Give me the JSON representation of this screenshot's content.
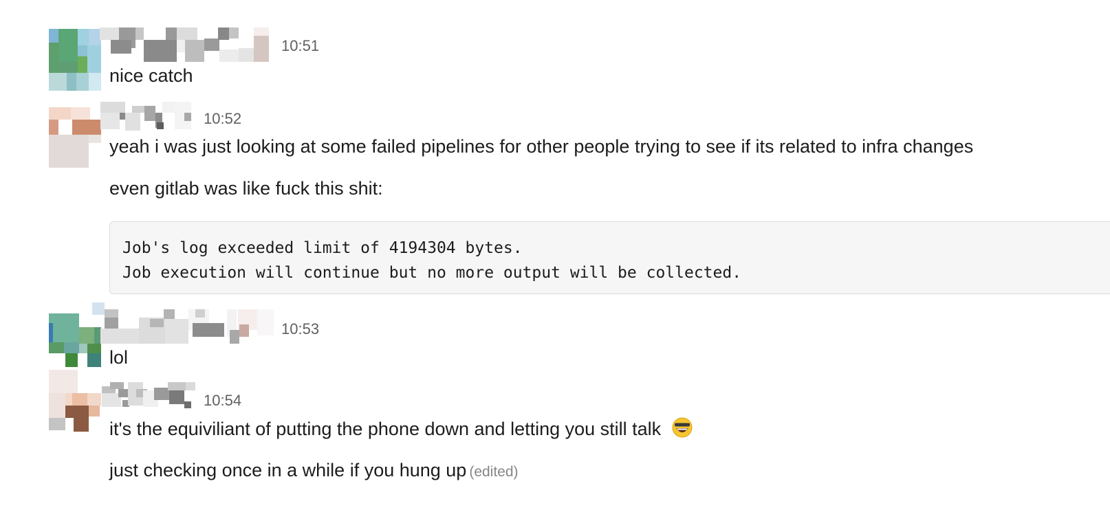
{
  "messages": [
    {
      "time": "10:51",
      "lines": [
        "nice catch"
      ]
    },
    {
      "time": "10:52",
      "lines": [
        "yeah i was just looking at some failed pipelines for other people trying to see if its related to infra changes",
        "even gitlab was like fuck this shit:"
      ],
      "code": [
        "Job's log exceeded limit of 4194304 bytes.",
        "Job execution will continue but no more output will be collected."
      ]
    },
    {
      "time": "10:53",
      "lines": [
        "lol"
      ]
    },
    {
      "time": "10:54",
      "lines": [
        "it's the equiviliant of putting the phone down and letting you still talk",
        "just checking once in a while if you hung up"
      ],
      "emoji": "grinning-face-with-sunglasses-emoji",
      "edited_label": "(edited)"
    }
  ]
}
